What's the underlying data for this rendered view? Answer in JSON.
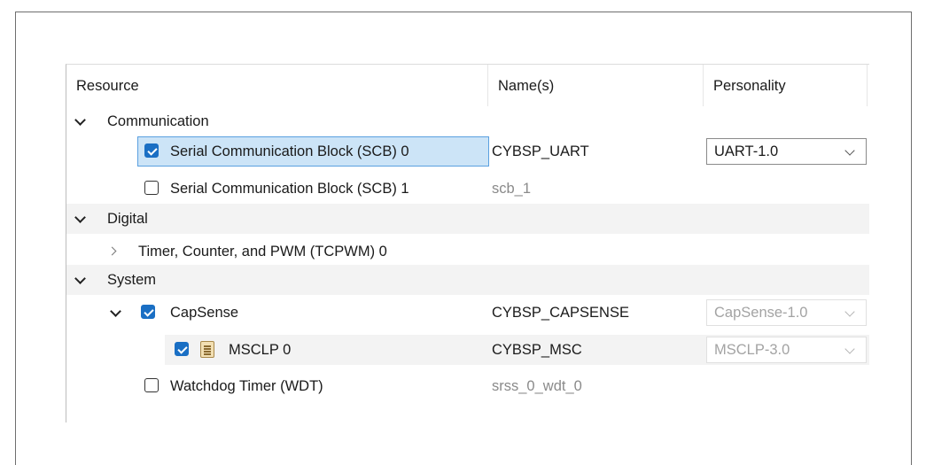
{
  "columns": {
    "resource": "Resource",
    "names": "Name(s)",
    "personality": "Personality"
  },
  "rows": [
    {
      "label": "Communication",
      "kind": "group",
      "expanded": true
    },
    {
      "label": "Serial Communication Block (SCB) 0",
      "checked": true,
      "selected": true,
      "name": "CYBSP_UART",
      "name_dim": false,
      "personality": "UART-1.0",
      "personality_enabled": true
    },
    {
      "label": "Serial Communication Block (SCB) 1",
      "checked": false,
      "name": "scb_1",
      "name_dim": true
    },
    {
      "label": "Digital",
      "kind": "group",
      "expanded": true
    },
    {
      "label": "Timer, Counter, and PWM (TCPWM) 0",
      "kind": "subgroup",
      "expanded": false
    },
    {
      "label": "System",
      "kind": "group",
      "expanded": true
    },
    {
      "label": "CapSense",
      "checked": true,
      "expanded": true,
      "name": "CYBSP_CAPSENSE",
      "name_dim": false,
      "personality": "CapSense-1.0",
      "personality_enabled": false
    },
    {
      "label": "MSCLP 0",
      "checked": true,
      "icon": "config-file-icon",
      "name": "CYBSP_MSC",
      "name_dim": false,
      "personality": "MSCLP-3.0",
      "personality_enabled": false
    },
    {
      "label": "Watchdog Timer (WDT)",
      "checked": false,
      "name": "srss_0_wdt_0",
      "name_dim": true
    }
  ],
  "colors": {
    "accent": "#1a6fc4",
    "selection": "#cce4f7",
    "row_shade": "#f3f3f3"
  }
}
